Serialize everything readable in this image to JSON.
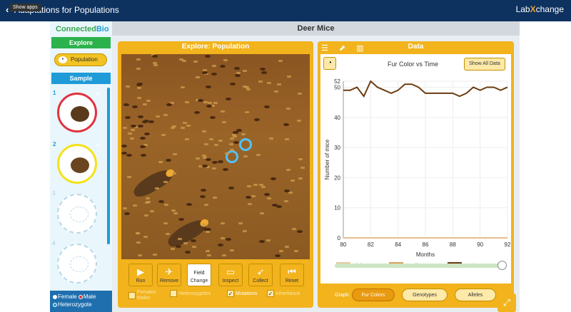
{
  "topbar": {
    "back": "‹",
    "title": "Adaptations for Populations",
    "tooltip": "Show apps",
    "logo_left": "Lab",
    "logo_x": "X",
    "logo_right": "change"
  },
  "left": {
    "brand_a": "Connected",
    "brand_b": "Bio",
    "explore": "Explore",
    "population": "Population",
    "sample": "Sample",
    "slots": [
      {
        "num": "1"
      },
      {
        "num": "2"
      },
      {
        "num": "3"
      },
      {
        "num": "4"
      }
    ],
    "legend": {
      "female": "Female",
      "male": "Male",
      "heterozygote": "Heterozygote"
    }
  },
  "main": {
    "header": "Deer Mice",
    "explore_title": "Explore: Population",
    "tools": {
      "run": "Run",
      "remove": "Remove",
      "field": "Field",
      "change": "Change",
      "inspect": "Inspect",
      "collect": "Collect",
      "reset": "Reset"
    },
    "checks": {
      "females_males_a": "Females",
      "females_males_b": "Males",
      "heterozygotes": "Heterozygotes",
      "mutations": "Mutations",
      "inheritance": "Inheritance"
    }
  },
  "data": {
    "title": "Data",
    "show_all": "Show All Data",
    "graph_label": "Graph:",
    "graph_buttons": [
      "Fur Colors",
      "Genotypes",
      "Alleles"
    ]
  },
  "chart_data": {
    "type": "line",
    "title": "Fur Color vs Time",
    "xlabel": "Months",
    "ylabel": "Number of mice",
    "xlim": [
      80,
      92
    ],
    "ylim": [
      0,
      52
    ],
    "xticks": [
      80,
      82,
      84,
      86,
      88,
      90,
      92
    ],
    "yticks": [
      0,
      10,
      20,
      30,
      40,
      50,
      52
    ],
    "x": [
      80,
      80.5,
      81,
      81.5,
      82,
      82.5,
      83,
      83.5,
      84,
      84.5,
      85,
      85.5,
      86,
      86.5,
      87,
      87.5,
      88,
      88.5,
      89,
      89.5,
      90,
      90.5,
      91,
      91.5,
      92
    ],
    "series": [
      {
        "name": "Light Brown",
        "color": "#e8c9a0",
        "values": [
          0,
          0,
          0,
          0,
          0,
          0,
          0,
          0,
          0,
          0,
          0,
          0,
          0,
          0,
          0,
          0,
          0,
          0,
          0,
          0,
          0,
          0,
          0,
          0,
          0
        ]
      },
      {
        "name": "Medium Brown",
        "color": "#d9a05a",
        "values": [
          0,
          0,
          0,
          0,
          0,
          0,
          0,
          0,
          0,
          0,
          0,
          0,
          0,
          0,
          0,
          0,
          0,
          0,
          0,
          0,
          0,
          0,
          0,
          0,
          0
        ]
      },
      {
        "name": "Dark Brown",
        "color": "#6b3d12",
        "values": [
          49,
          49,
          50,
          47,
          52,
          50,
          49,
          48,
          49,
          51,
          51,
          50,
          48,
          48,
          48,
          48,
          48,
          47,
          48,
          50,
          49,
          50,
          50,
          49,
          50
        ]
      }
    ]
  }
}
